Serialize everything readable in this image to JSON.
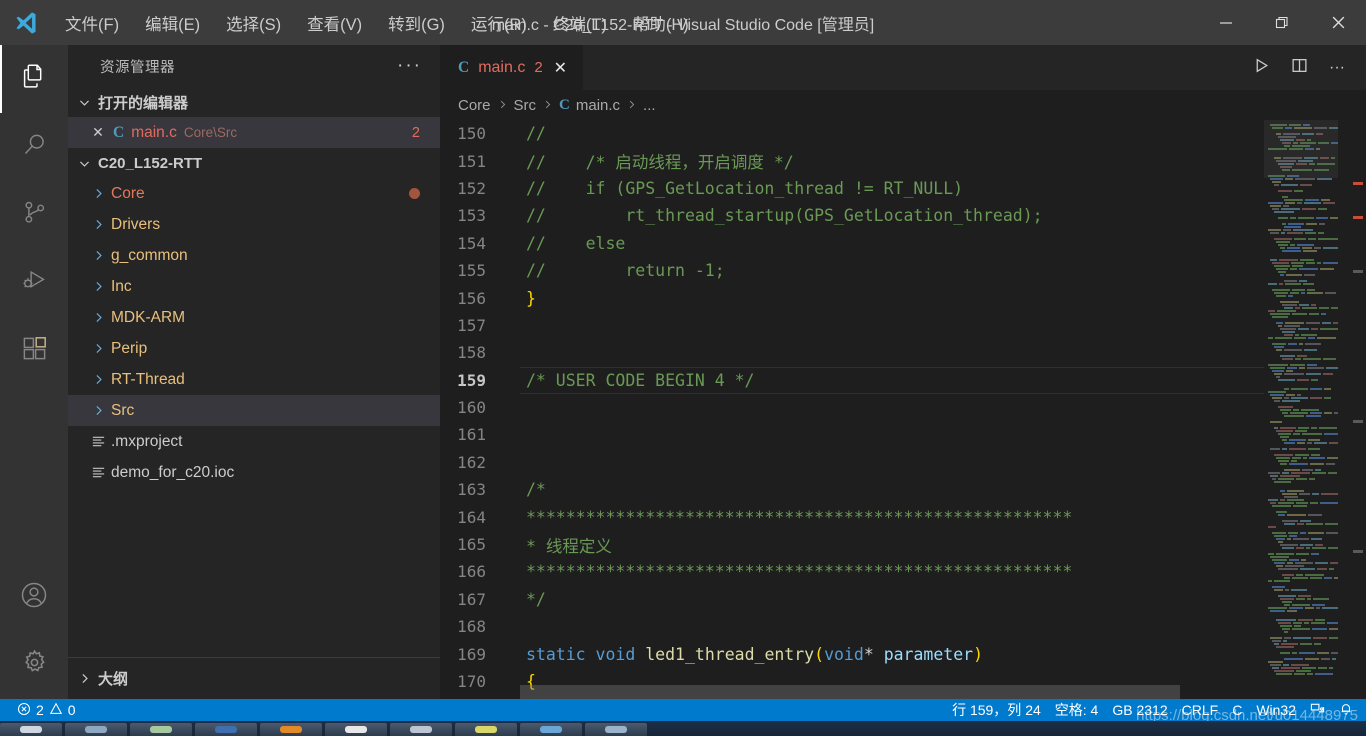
{
  "window": {
    "title": "main.c - C20_L152-RTT - Visual Studio Code [管理员]",
    "minimize_label": "—",
    "maximize_label": "❐",
    "close_label": "✕"
  },
  "menubar": {
    "items": [
      {
        "label": "文件(F)",
        "name": "menu-file"
      },
      {
        "label": "编辑(E)",
        "name": "menu-edit"
      },
      {
        "label": "选择(S)",
        "name": "menu-selection"
      },
      {
        "label": "查看(V)",
        "name": "menu-view"
      },
      {
        "label": "转到(G)",
        "name": "menu-go"
      },
      {
        "label": "运行(R)",
        "name": "menu-run"
      },
      {
        "label": "终端(T)",
        "name": "menu-terminal"
      },
      {
        "label": "帮助(H)",
        "name": "menu-help"
      }
    ]
  },
  "activitybar": {
    "items": [
      {
        "icon": "explorer-icon",
        "active": true
      },
      {
        "icon": "search-icon",
        "active": false
      },
      {
        "icon": "source-control-icon",
        "active": false
      },
      {
        "icon": "run-and-debug-icon",
        "active": false
      },
      {
        "icon": "extensions-icon",
        "active": false
      }
    ],
    "bottom": [
      {
        "icon": "account-icon"
      },
      {
        "icon": "gear-icon"
      }
    ]
  },
  "sidebar": {
    "title": "资源管理器",
    "more_actions": "···",
    "open_editors": {
      "label": "打开的编辑器",
      "expanded": true,
      "rows": [
        {
          "close": "✕",
          "lang_badge": "C",
          "name": "main.c",
          "path": "Core\\Src",
          "count": "2",
          "selected": true
        }
      ]
    },
    "project": {
      "label": "C20_L152-RTT",
      "expanded": true,
      "items": [
        {
          "label": "Core",
          "type": "folder",
          "modified": true
        },
        {
          "label": "Drivers",
          "type": "folder",
          "modified": false
        },
        {
          "label": "g_common",
          "type": "folder",
          "modified": false
        },
        {
          "label": "Inc",
          "type": "folder",
          "modified": false
        },
        {
          "label": "MDK-ARM",
          "type": "folder",
          "modified": false
        },
        {
          "label": "Perip",
          "type": "folder",
          "modified": false
        },
        {
          "label": "RT-Thread",
          "type": "folder",
          "modified": false
        },
        {
          "label": "Src",
          "type": "folder",
          "modified": false,
          "selected": true
        },
        {
          "label": ".mxproject",
          "type": "file",
          "modified": false
        },
        {
          "label": "demo_for_c20.ioc",
          "type": "file",
          "modified": false
        }
      ]
    },
    "outline": {
      "label": "大纲",
      "expanded": false
    }
  },
  "editor": {
    "tabs": [
      {
        "lang_badge": "C",
        "name": "main.c",
        "count": "2",
        "close": "✕",
        "active": true
      }
    ],
    "actions": [
      {
        "icon": "run-icon"
      },
      {
        "icon": "split-editor-icon"
      },
      {
        "icon": "more-actions-icon",
        "label": "···"
      }
    ],
    "breadcrumbs": [
      {
        "label": "Core",
        "type": "folder"
      },
      {
        "label": "Src",
        "type": "folder"
      },
      {
        "label": "main.c",
        "type": "file",
        "badge": "C"
      },
      {
        "label": "...",
        "type": "symbol"
      }
    ],
    "lines": [
      {
        "n": "150",
        "tokens": [
          {
            "t": "//",
            "c": "cm"
          }
        ]
      },
      {
        "n": "151",
        "tokens": [
          {
            "t": "//    /* 启动线程，开启调度 */",
            "c": "cm"
          }
        ]
      },
      {
        "n": "152",
        "tokens": [
          {
            "t": "//    if (GPS_GetLocation_thread != RT_NULL)",
            "c": "cm"
          }
        ]
      },
      {
        "n": "153",
        "tokens": [
          {
            "t": "//        rt_thread_startup(GPS_GetLocation_thread);",
            "c": "cm"
          }
        ]
      },
      {
        "n": "154",
        "tokens": [
          {
            "t": "//    else",
            "c": "cm"
          }
        ]
      },
      {
        "n": "155",
        "tokens": [
          {
            "t": "//        return -1;",
            "c": "cm"
          }
        ]
      },
      {
        "n": "156",
        "tokens": [
          {
            "t": "}",
            "c": "br"
          }
        ]
      },
      {
        "n": "157",
        "tokens": []
      },
      {
        "n": "158",
        "tokens": []
      },
      {
        "n": "159",
        "tokens": [
          {
            "t": "/* USER CODE BEGIN 4 */",
            "c": "cm"
          }
        ],
        "current": true
      },
      {
        "n": "160",
        "tokens": []
      },
      {
        "n": "161",
        "tokens": []
      },
      {
        "n": "162",
        "tokens": []
      },
      {
        "n": "163",
        "tokens": [
          {
            "t": "/*",
            "c": "cm"
          }
        ]
      },
      {
        "n": "164",
        "tokens": [
          {
            "t": "*******************************************************",
            "c": "cm"
          }
        ]
      },
      {
        "n": "165",
        "tokens": [
          {
            "t": "* 线程定义",
            "c": "cm"
          }
        ]
      },
      {
        "n": "166",
        "tokens": [
          {
            "t": "*******************************************************",
            "c": "cm"
          }
        ]
      },
      {
        "n": "167",
        "tokens": [
          {
            "t": "*/",
            "c": "cm"
          }
        ]
      },
      {
        "n": "168",
        "tokens": []
      },
      {
        "n": "169",
        "tokens": [
          {
            "t": "static",
            "c": "kw"
          },
          {
            "t": " ",
            "c": "pu"
          },
          {
            "t": "void",
            "c": "kw"
          },
          {
            "t": " ",
            "c": "pu"
          },
          {
            "t": "led1_thread_entry",
            "c": "fn"
          },
          {
            "t": "(",
            "c": "br"
          },
          {
            "t": "void",
            "c": "kw"
          },
          {
            "t": "*",
            "c": "pu"
          },
          {
            "t": " ",
            "c": "pu"
          },
          {
            "t": "parameter",
            "c": "pn"
          },
          {
            "t": ")",
            "c": "br"
          }
        ]
      },
      {
        "n": "170",
        "tokens": [
          {
            "t": "{",
            "c": "br"
          }
        ]
      }
    ]
  },
  "statusbar": {
    "errors_icon": "error-icon",
    "errors": "2",
    "warnings_icon": "warning-icon",
    "warnings": "0",
    "cursor_position": "行 159，列 24",
    "indentation": "空格: 4",
    "encoding": "GB 2312",
    "eol": "CRLF",
    "language": "C",
    "platform": "Win32",
    "remote_icon": "remote-icon",
    "bell_icon": "bell-icon"
  },
  "watermark": {
    "text": "https://blog.csdn.net/u014448975"
  },
  "colors": {
    "accent": "#007acc",
    "titlebar_bg": "#3c3c3c",
    "activitybar_bg": "#333333",
    "sidebar_bg": "#252526",
    "editor_bg": "#1e1e1e",
    "selection_bg": "#37373d",
    "comment_green": "#6a9955",
    "keyword_blue": "#569cd6",
    "function_yellow": "#dcdcaa",
    "string_orange": "#e06c60",
    "folder_yellow": "#e8c07d"
  }
}
